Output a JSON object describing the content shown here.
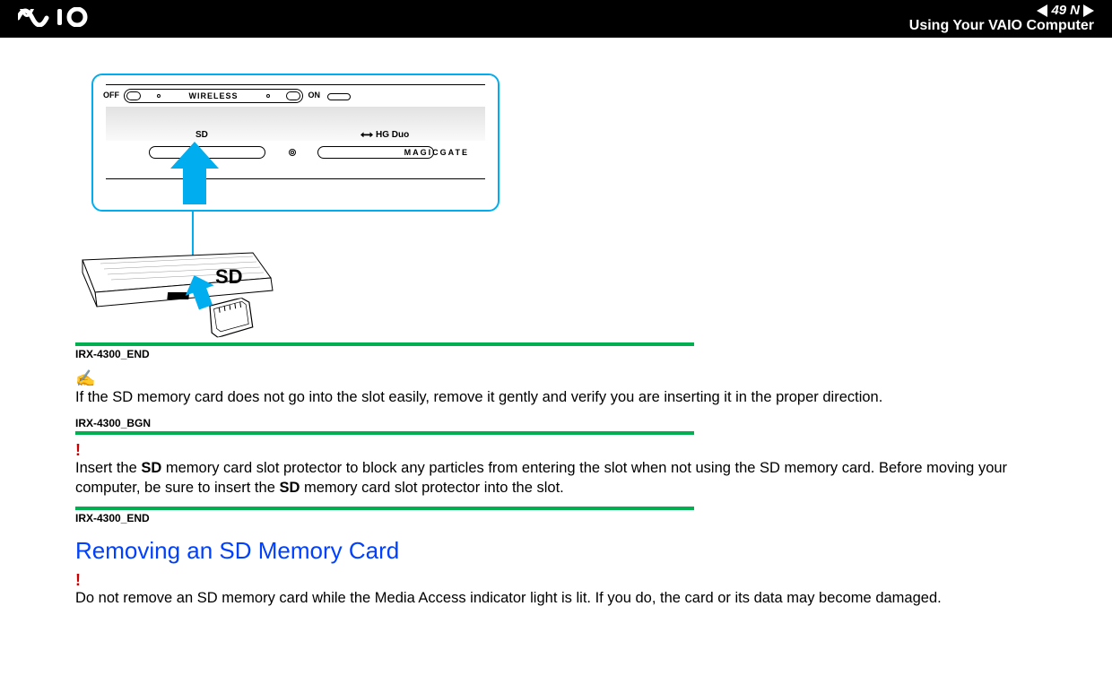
{
  "header": {
    "page_number": "49",
    "n_letter": "N",
    "title": "Using Your VAIO Computer",
    "logo_alt": "VAIO"
  },
  "illustration": {
    "off": "OFF",
    "on": "ON",
    "wireless": "WIRELESS",
    "sd_small": "SD",
    "hg_duo": "HG Duo",
    "magicgate": "MAGICGATE",
    "sd_big": "SD"
  },
  "markers": {
    "end1": "IRX-4300_END",
    "bgn": "IRX-4300_BGN",
    "end2": "IRX-4300_END"
  },
  "notes": {
    "note_icon": "✍",
    "tip_text": "If the SD memory card does not go into the slot easily, remove it gently and verify you are inserting it in the proper direction.",
    "warn1_pre": "Insert the ",
    "warn1_sd1": "SD",
    "warn1_mid": " memory card slot protector to block any particles from entering the slot when not using the SD memory card. Before moving your computer, be sure to insert the ",
    "warn1_sd2": "SD",
    "warn1_post": " memory card slot protector into the slot.",
    "exclaim": "!"
  },
  "section2": {
    "heading": "Removing an SD Memory Card",
    "warn_text": "Do not remove an SD memory card while the Media Access indicator light is lit. If you do, the card or its data may become damaged."
  }
}
